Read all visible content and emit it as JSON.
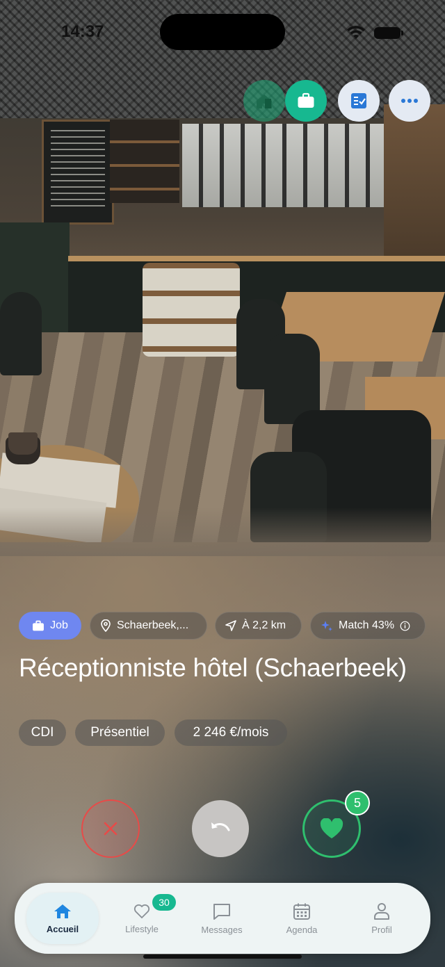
{
  "status_bar": {
    "time": "14:37"
  },
  "top_actions": [
    {
      "icon": "home-icon"
    },
    {
      "icon": "briefcase-icon"
    },
    {
      "icon": "checklist-icon"
    },
    {
      "icon": "more-icon"
    }
  ],
  "card": {
    "pills": {
      "type": "Job",
      "location": "Schaerbeek,...",
      "distance": "À 2,2 km",
      "match": "Match 43%"
    },
    "title": "Réceptionniste hôtel (Schaerbeek)",
    "tags": [
      "CDI",
      "Présentiel",
      "2 246 €/mois"
    ]
  },
  "actions": {
    "like_count": "5"
  },
  "colors": {
    "accent": "#17b890",
    "job_pill": "#6f87f0",
    "reject": "#e84a48",
    "like": "#2fbf6e"
  },
  "tabbar": {
    "items": [
      {
        "label": "Accueil",
        "icon": "home-icon",
        "active": true
      },
      {
        "label": "Lifestyle",
        "icon": "lifestyle-icon",
        "badge": "30"
      },
      {
        "label": "Messages",
        "icon": "message-icon"
      },
      {
        "label": "Agenda",
        "icon": "calendar-icon"
      },
      {
        "label": "Profil",
        "icon": "profile-icon"
      }
    ]
  }
}
